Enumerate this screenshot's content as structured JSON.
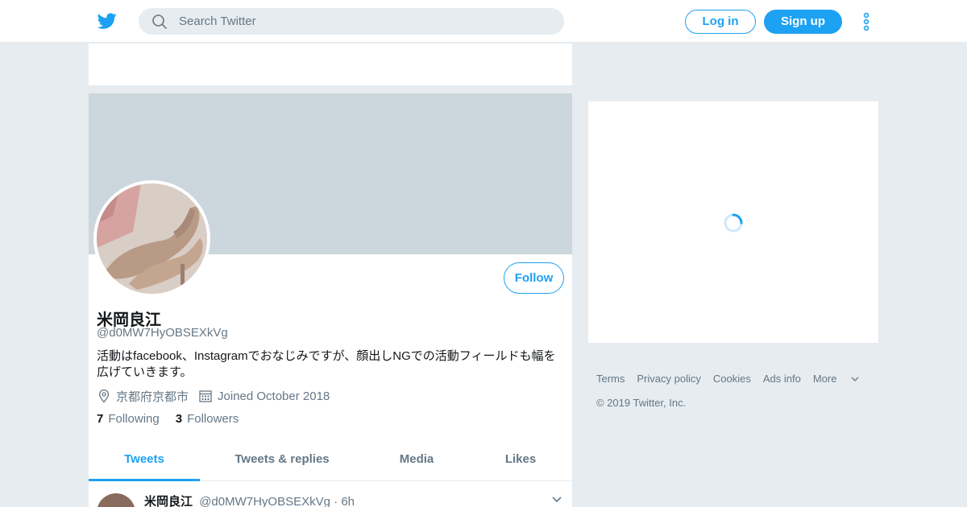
{
  "colors": {
    "accent": "#1da1f2",
    "background": "#e6ecf0",
    "banner": "#ccd6dd",
    "text": "#14171a",
    "muted": "#657786"
  },
  "nav": {
    "logo_icon": "twitter-bird-icon",
    "search_placeholder": "Search Twitter",
    "login_label": "Log in",
    "signup_label": "Sign up",
    "more_icon": "vertical-dots-icon"
  },
  "profile": {
    "name": "米岡良江",
    "handle": "@d0MW7HyOBSEXkVg",
    "bio_line1": "活動はfacebook、Instagramでおなじみですが、顔出しNGでの活動フィールドも幅を",
    "bio_line2": "広げていきます。",
    "location": "京都府京都市",
    "joined": "Joined October 2018",
    "following_count": "7",
    "following_label": "Following",
    "followers_count": "3",
    "followers_label": "Followers",
    "follow_button": "Follow"
  },
  "tabs": [
    {
      "label": "Tweets",
      "active": true
    },
    {
      "label": "Tweets & replies",
      "active": false
    },
    {
      "label": "Media",
      "active": false
    },
    {
      "label": "Likes",
      "active": false
    }
  ],
  "tweet": {
    "name": "米岡良江",
    "handle": "@d0MW7HyOBSEXkVg",
    "separator": "·",
    "time": "6h"
  },
  "footer": {
    "links": [
      "Terms",
      "Privacy policy",
      "Cookies",
      "Ads info"
    ],
    "more": "More",
    "copyright": "© 2019 Twitter, Inc."
  }
}
